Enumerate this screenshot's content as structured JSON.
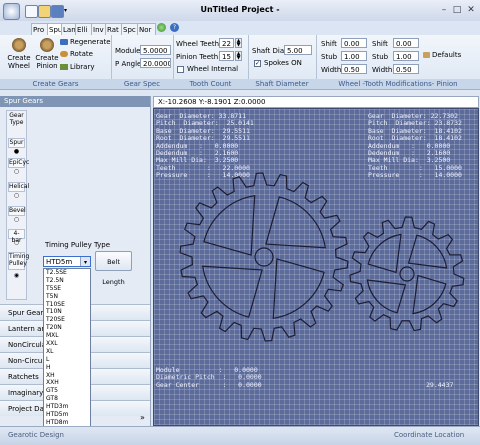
{
  "window": {
    "title": "UnTitled Project -",
    "minimize": "–",
    "maximize": "□",
    "close": "✕"
  },
  "ribbon_tabs": [
    "Pro",
    "Spu",
    "Lan",
    "Elli",
    "Inv",
    "Rat",
    "Spc",
    "Nor"
  ],
  "groups": {
    "create_gears": {
      "label": "Create Gears",
      "create_wheel": "Create Wheel",
      "create_pinion": "Create Pinion",
      "regenerate": "Regenerate",
      "rotate": "Rotate",
      "library": "Library"
    },
    "gear_spec": {
      "label": "Gear Spec",
      "module_label": "Module",
      "module_value": "5.0000",
      "pangle_label": "P Angle",
      "pangle_value": "20.0000"
    },
    "tooth_count": {
      "label": "Tooth Count",
      "wheel_teeth_label": "Wheel Teeth",
      "wheel_teeth_value": "22",
      "pinion_teeth_label": "Pinion Teeth",
      "pinion_teeth_value": "15",
      "wheel_internal_label": "Wheel Internal"
    },
    "shaft_diameter": {
      "label": "Shaft Diameter",
      "shaft_dia_label": "Shaft Dia.",
      "shaft_dia_value": "5.00",
      "spokes_label": "Spokes ON"
    },
    "tooth_mods": {
      "label": "Wheel -Tooth Modifications- Pinion",
      "shift_label": "Shift",
      "stub_label": "Stub",
      "width_label": "Width",
      "wheel_shift": "0.00",
      "wheel_stub": "1.00",
      "wheel_width": "0.50",
      "pinion_shift": "0.00",
      "pinion_stub": "1.00",
      "pinion_width": "0.50",
      "defaults": "Defaults"
    }
  },
  "left_panel": {
    "header": "Spur Gears",
    "side_buttons": [
      "Gear Type",
      "Spur",
      "EpiCyc",
      "Helical",
      "Bevel",
      "4-bar",
      "Timing Pulley"
    ],
    "pulley_type_label": "Timing Pulley Type",
    "pulley_selected": "HTD5m",
    "belt_length_button": "Belt Length",
    "pulley_options": [
      "T2.5SE",
      "T2.5N",
      "T5SE",
      "T5N",
      "T10SE",
      "T10N",
      "T20SE",
      "T20N",
      "MXL",
      "XXL",
      "XL",
      "L",
      "H",
      "XH",
      "XXH",
      "GT5",
      "GT8",
      "HTD3m",
      "HTD5m",
      "HTD8m",
      "HTD14m"
    ],
    "pulley_highlighted": "HTD14m",
    "nav_items": [
      "Spur Gears",
      "Lantern and",
      "NonCircula",
      "Non-Circul",
      "Ratchets",
      "Imaginary",
      "Project Dat"
    ],
    "more_chevron": "»"
  },
  "coords": "X:-10.2608 Y:-8.1901 Z:0.0000",
  "wheel_info": [
    "Gear  Diameter: 33.8711",
    "Pitch  Diameter:  25.0141",
    "Base  Diameter:  29.5511",
    "Root  Diameter:  29.5511",
    "Addendum   :   0.0000",
    "Dedendum   :   2.1600",
    "Max Mill Dia:  3.2500",
    "Teeth        :   22.0000",
    "Pressure     :   14.0000"
  ],
  "pinion_info": [
    "Gear  Diameter: 22.7302",
    "Pitch  Diameter: 23.8732",
    "Base  Diameter:  18.4102",
    "Root  Diameter:  18.4102",
    "Addendum   :   0.0000",
    "Dedendum   :   2.1600",
    "Max Mill Dia:  3.2500",
    "Teeth        :   15.0000",
    "Pressure     :   14.0000"
  ],
  "bottom_info": [
    "Module          :   0.0000",
    "Diametric Pitch  :   0.0000",
    "Gear Center      :   0.0000"
  ],
  "bottom_info_right": "29.4437",
  "status": {
    "left": "Gearotic Design",
    "right": "Coordinate Location"
  },
  "chart_data": null
}
